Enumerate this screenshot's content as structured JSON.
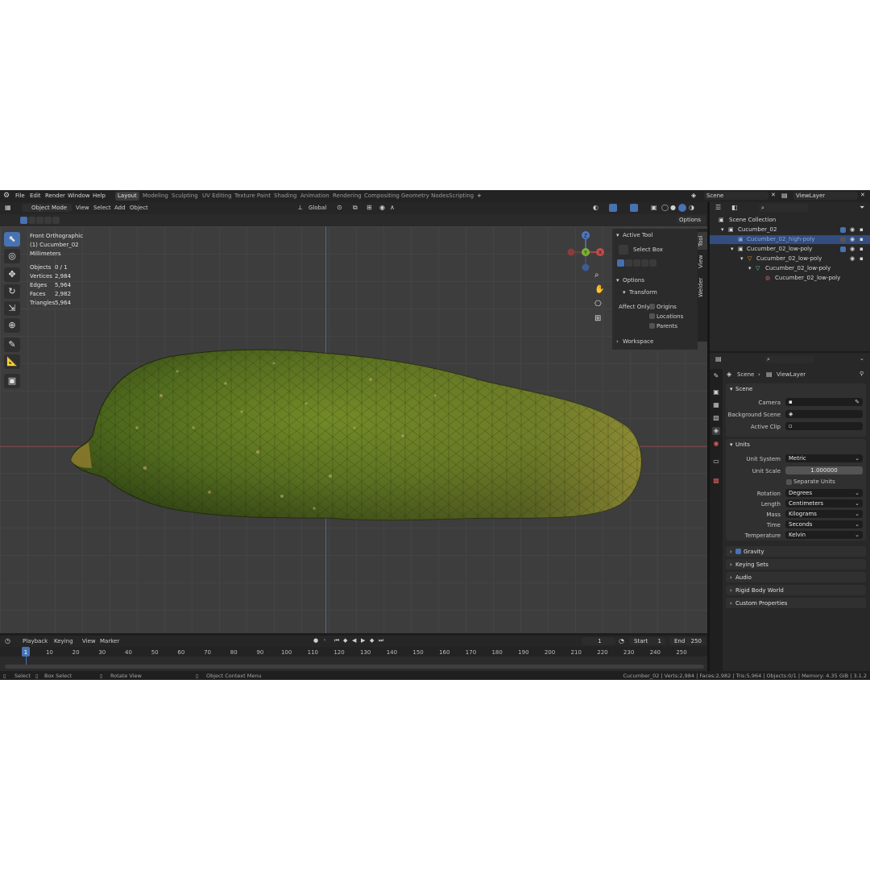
{
  "menu": {
    "items": [
      "File",
      "Edit",
      "Render",
      "Window",
      "Help"
    ]
  },
  "workspaces": [
    "Layout",
    "Modeling",
    "Sculpting",
    "UV Editing",
    "Texture Paint",
    "Shading",
    "Animation",
    "Rendering",
    "Compositing",
    "Geometry Nodes",
    "Scripting"
  ],
  "workspace_add": "+",
  "scene_field": "Scene",
  "viewlayer_field": "ViewLayer",
  "viewport_header": {
    "mode": "Object Mode",
    "menus": [
      "View",
      "Select",
      "Add",
      "Object"
    ],
    "orientation": "Global",
    "options": "Options"
  },
  "viewport_info": {
    "view": "Front Orthographic",
    "object": "(1) Cucumber_02",
    "units": "Millimeters",
    "stats": [
      {
        "label": "Objects",
        "value": "0 / 1"
      },
      {
        "label": "Vertices",
        "value": "2,984"
      },
      {
        "label": "Edges",
        "value": "5,964"
      },
      {
        "label": "Faces",
        "value": "2,982"
      },
      {
        "label": "Triangles",
        "value": "5,964"
      }
    ]
  },
  "gizmo": {
    "z": "Z",
    "y": "Y",
    "x": "X"
  },
  "npanel": {
    "active_tool_title": "Active Tool",
    "tool_name": "Select Box",
    "options_title": "Options",
    "transform_title": "Transform",
    "affect_only_label": "Affect Only",
    "affect_options": [
      "Origins",
      "Locations",
      "Parents"
    ],
    "workspace_title": "Workspace",
    "tabs": [
      "Tool",
      "View",
      "Welder"
    ]
  },
  "timeline": {
    "menus": [
      "Playback",
      "Keying",
      "View",
      "Marker"
    ],
    "current_frame": "1",
    "start_label": "Start",
    "start_value": "1",
    "end_label": "End",
    "end_value": "250",
    "ticks": [
      "1",
      "10",
      "20",
      "30",
      "40",
      "50",
      "60",
      "70",
      "80",
      "90",
      "100",
      "110",
      "120",
      "130",
      "140",
      "150",
      "160",
      "170",
      "180",
      "190",
      "200",
      "210",
      "220",
      "230",
      "240",
      "250"
    ],
    "cursor_frame": 1,
    "frame_range": [
      1,
      250
    ]
  },
  "statusbar": {
    "select": "Select",
    "box_select": "Box Select",
    "rotate_view": "Rotate View",
    "context_menu": "Object Context Menu",
    "stats": "Cucumber_02 | Verts:2,984 | Faces:2,982 | Tris:5,964 | Objects:0/1 | Memory: 4.35 GiB | 3.1.2"
  },
  "outliner": {
    "rows": [
      {
        "label": "Scene Collection",
        "indent": 0
      },
      {
        "label": "Cucumber_02",
        "indent": 1
      },
      {
        "label": "Cucumber_02_high-poly",
        "indent": 2,
        "selected": true
      },
      {
        "label": "Cucumber_02_low-poly",
        "indent": 2
      },
      {
        "label": "Cucumber_02_low-poly",
        "indent": 3
      },
      {
        "label": "Cucumber_02_low-poly",
        "indent": 4
      },
      {
        "label": "Cucumber_02_low-poly",
        "indent": 5
      }
    ]
  },
  "properties": {
    "breadcrumb_scene": "Scene",
    "breadcrumb_layer": "ViewLayer",
    "scene_panel": {
      "title": "Scene",
      "camera_label": "Camera",
      "background_label": "Background Scene",
      "clip_label": "Active Clip"
    },
    "units_panel": {
      "title": "Units",
      "unit_system_label": "Unit System",
      "unit_system": "Metric",
      "unit_scale_label": "Unit Scale",
      "unit_scale": "1.000000",
      "separate_units": "Separate Units",
      "rotation_label": "Rotation",
      "rotation": "Degrees",
      "length_label": "Length",
      "length": "Centimeters",
      "mass_label": "Mass",
      "mass": "Kilograms",
      "time_label": "Time",
      "time": "Seconds",
      "temperature_label": "Temperature",
      "temperature": "Kelvin"
    },
    "collapsed": [
      "Gravity",
      "Keying Sets",
      "Audio",
      "Rigid Body World",
      "Custom Properties"
    ]
  },
  "colors": {
    "accent": "#4772b3",
    "viewport": "#3d3d3d",
    "selected_row": "#334d80"
  }
}
